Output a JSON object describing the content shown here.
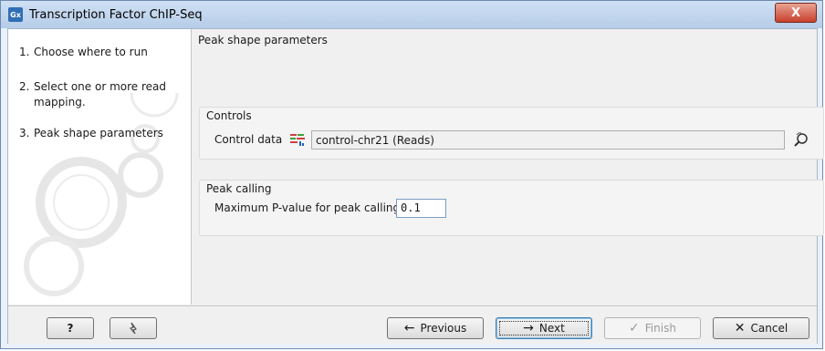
{
  "window": {
    "app_icon_text": "Gx",
    "title": "Transcription Factor ChIP-Seq",
    "close_glyph": "X"
  },
  "steps": [
    {
      "num": "1.",
      "label": "Choose where to run"
    },
    {
      "num": "2.",
      "label": "Select one or more read mapping."
    },
    {
      "num": "3.",
      "label": "Peak shape parameters"
    }
  ],
  "content": {
    "page_title": "Peak shape parameters",
    "controls": {
      "legend": "Controls",
      "label": "Control data",
      "value": "control-chr21 (Reads)"
    },
    "peak_calling": {
      "legend": "Peak calling",
      "label": "Maximum P-value for peak calling",
      "value": "0.1"
    }
  },
  "buttons": {
    "help": "?",
    "previous": "Previous",
    "next": "Next",
    "finish": "Finish",
    "cancel": "Cancel"
  },
  "icons": {
    "reads": "reads-icon",
    "browse": "browse-icon",
    "reset": "reset-icon"
  }
}
